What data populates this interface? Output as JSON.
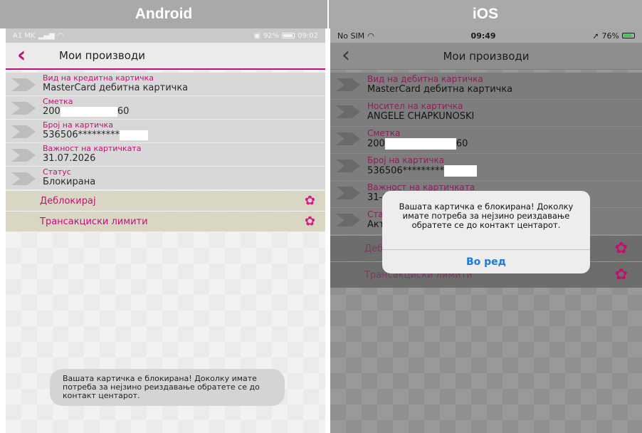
{
  "columns": {
    "android": "Android",
    "ios": "iOS"
  },
  "android": {
    "status": {
      "carrier": "A1 MK",
      "battery": "92%",
      "time": "09:02"
    },
    "title": "Мои производи",
    "rows": [
      {
        "label": "Вид на кредитна картичка",
        "value": "MasterCard дебитна картичка"
      },
      {
        "label": "Сметка",
        "value_prefix": "200",
        "value_suffix": "60"
      },
      {
        "label": "Број на картичка",
        "value_prefix": "536506*********"
      },
      {
        "label": "Важност на картичката",
        "value": "31.07.2026"
      },
      {
        "label": "Статус",
        "value": "Блокирана"
      }
    ],
    "actions": [
      "Деблокирај",
      "Трансакциски лимити"
    ],
    "toast": "Вашата картичка е блокирана! Доколку имате потреба за нејзино реиздавање обратете се до контакт центарот."
  },
  "ios": {
    "status": {
      "carrier": "No SIM",
      "time": "09:49",
      "battery": "76%"
    },
    "title": "Мои производи",
    "rows": [
      {
        "label": "Вид на дебитна картичка",
        "value": "MasterCard дебитна картичка"
      },
      {
        "label": "Носител на картичка",
        "value": "ANGELE CHAPKUNOSKI"
      },
      {
        "label": "Сметка",
        "value_prefix": "200",
        "value_suffix": "60"
      },
      {
        "label": "Број на картичка",
        "value_prefix": "536506*********"
      },
      {
        "label": "Важност на картичката",
        "value": "31-0"
      },
      {
        "label": "Ста",
        "value": "Акти"
      }
    ],
    "actions": [
      "Деб",
      "Трансакциски лимити"
    ],
    "alert": {
      "message": "Вашата картичка е блокирана! Доколку имате потреба за нејзино реиздавање обратете се до контакт центарот.",
      "button": "Во ред"
    }
  },
  "colors": {
    "accent": "#c0117b",
    "ios_link": "#1a7ae0"
  },
  "icons": {
    "back": "chevron-left-icon",
    "gear": "gear-icon",
    "row": "arrow-shape-icon"
  }
}
